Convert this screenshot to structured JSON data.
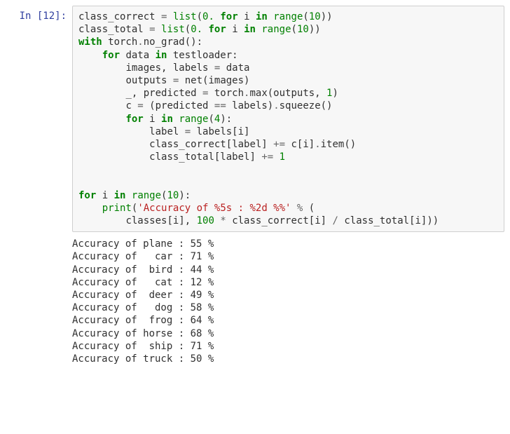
{
  "prompt": {
    "label": "In [12]:"
  },
  "code": {
    "l1": {
      "t1": "class_correct ",
      "op1": "=",
      "t2": " ",
      "b1": "list",
      "t3": "(",
      "n1": "0.",
      "t4": " ",
      "k1": "for",
      "t5": " i ",
      "k2": "in",
      "t6": " ",
      "b2": "range",
      "t7": "(",
      "n2": "10",
      "t8": "))"
    },
    "l2": {
      "t1": "class_total ",
      "op1": "=",
      "t2": " ",
      "b1": "list",
      "t3": "(",
      "n1": "0.",
      "t4": " ",
      "k1": "for",
      "t5": " i ",
      "k2": "in",
      "t6": " ",
      "b2": "range",
      "t7": "(",
      "n2": "10",
      "t8": "))"
    },
    "l3": {
      "k1": "with",
      "t1": " torch",
      "op1": ".",
      "t2": "no_grad():"
    },
    "l4": {
      "sp": "    ",
      "k1": "for",
      "t1": " data ",
      "k2": "in",
      "t2": " testloader:"
    },
    "l5": {
      "sp": "        ",
      "t1": "images, labels ",
      "op1": "=",
      "t2": " data"
    },
    "l6": {
      "sp": "        ",
      "t1": "outputs ",
      "op1": "=",
      "t2": " net(images)"
    },
    "l7": {
      "sp": "        ",
      "t1": "_, predicted ",
      "op1": "=",
      "t2": " torch",
      "op2": ".",
      "t3": "max(outputs, ",
      "n1": "1",
      "t4": ")"
    },
    "l8": {
      "sp": "        ",
      "t1": "c ",
      "op1": "=",
      "t2": " (predicted ",
      "op2": "==",
      "t3": " labels)",
      "op3": ".",
      "t4": "squeeze()"
    },
    "l9": {
      "sp": "        ",
      "k1": "for",
      "t1": " i ",
      "k2": "in",
      "t2": " ",
      "b1": "range",
      "t3": "(",
      "n1": "4",
      "t4": "):"
    },
    "l10": {
      "sp": "            ",
      "t1": "label ",
      "op1": "=",
      "t2": " labels[i]"
    },
    "l11": {
      "sp": "            ",
      "t1": "class_correct[label] ",
      "op1": "+=",
      "t2": " c[i]",
      "op2": ".",
      "t3": "item()"
    },
    "l12": {
      "sp": "            ",
      "t1": "class_total[label] ",
      "op1": "+=",
      "t2": " ",
      "n1": "1"
    },
    "l13": {
      "k1": "for",
      "t1": " i ",
      "k2": "in",
      "t2": " ",
      "b1": "range",
      "t3": "(",
      "n1": "10",
      "t4": "):"
    },
    "l14": {
      "sp": "    ",
      "b1": "print",
      "t1": "(",
      "s1": "'Accuracy of %5s : %2d %%'",
      "t2": " ",
      "op1": "%",
      "t3": " ("
    },
    "l15": {
      "sp": "        ",
      "t1": "classes[i], ",
      "n1": "100",
      "t2": " ",
      "op1": "*",
      "t3": " class_correct[i] ",
      "op2": "/",
      "t4": " class_total[i]))"
    }
  },
  "output": {
    "lines": [
      "Accuracy of plane : 55 %",
      "Accuracy of   car : 71 %",
      "Accuracy of  bird : 44 %",
      "Accuracy of   cat : 12 %",
      "Accuracy of  deer : 49 %",
      "Accuracy of   dog : 58 %",
      "Accuracy of  frog : 64 %",
      "Accuracy of horse : 68 %",
      "Accuracy of  ship : 71 %",
      "Accuracy of truck : 50 %"
    ]
  }
}
